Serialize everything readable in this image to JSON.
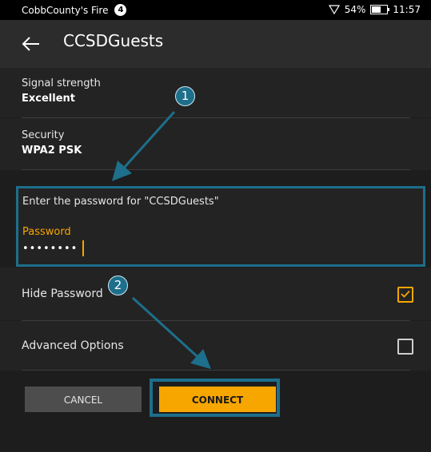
{
  "status_bar": {
    "owner": "CobbCounty's Fire",
    "notification_count": "4",
    "battery_text": "54%",
    "battery_level": 0.54,
    "time": "11:57"
  },
  "app_bar": {
    "title": "CCSDGuests",
    "back_icon": "arrow-left-icon"
  },
  "details": {
    "signal_label": "Signal strength",
    "signal_value": "Excellent",
    "security_label": "Security",
    "security_value": "WPA2 PSK"
  },
  "password_section": {
    "prompt": "Enter the password for \"CCSDGuests\"",
    "label": "Password",
    "masked_value": "••••••••"
  },
  "options": {
    "hide_password_label": "Hide Password",
    "hide_password_checked": true,
    "advanced_label": "Advanced Options",
    "advanced_checked": false
  },
  "buttons": {
    "cancel": "CANCEL",
    "connect": "CONNECT"
  },
  "annotations": {
    "step1": "1",
    "step2": "2"
  },
  "colors": {
    "accent": "#f7a600",
    "callout": "#1d6f8b",
    "background": "#1d1d1d"
  }
}
